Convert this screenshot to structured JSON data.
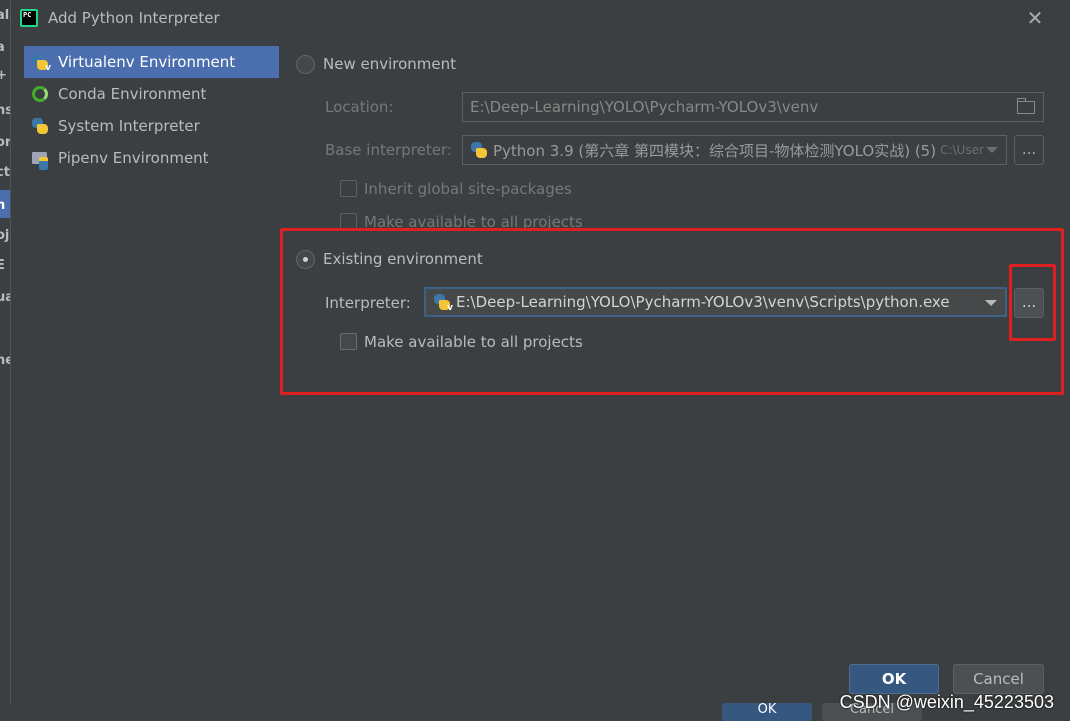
{
  "window": {
    "title": "Add Python Interpreter",
    "close_symbol": "✕"
  },
  "sidebar": {
    "items": [
      {
        "label": "Virtualenv Environment",
        "icon": "virtualenv-icon",
        "active": true
      },
      {
        "label": "Conda Environment",
        "icon": "conda-icon",
        "active": false
      },
      {
        "label": "System Interpreter",
        "icon": "python-icon",
        "active": false
      },
      {
        "label": "Pipenv Environment",
        "icon": "pipenv-icon",
        "active": false
      }
    ]
  },
  "new_env": {
    "radio_label": "New environment",
    "location_label": "Location:",
    "location_value": "E:\\Deep-Learning\\YOLO\\Pycharm-YOLOv3\\venv",
    "base_label": "Base interpreter:",
    "base_value": "Python 3.9 (第六章 第四模块：综合项目-物体检测YOLO实战) (5)",
    "base_suffix": "C:\\User",
    "browse_label": "...",
    "inherit_label": "Inherit global site-packages",
    "make_available_label": "Make available to all projects"
  },
  "existing_env": {
    "radio_label": "Existing environment",
    "interpreter_label": "Interpreter:",
    "interpreter_value": "E:\\Deep-Learning\\YOLO\\Pycharm-YOLOv3\\venv\\Scripts\\python.exe",
    "browse_label": "...",
    "make_available_label": "Make available to all projects"
  },
  "buttons": {
    "ok": "OK",
    "cancel": "Cancel"
  },
  "background": {
    "left_fragments": [
      "al",
      "a",
      "+",
      "ns",
      "or",
      "ct",
      "h",
      "oj",
      "E",
      "ua",
      "ne"
    ],
    "bottom_ok": "OK",
    "bottom_cancel": "Cancel"
  },
  "watermark": "CSDN @weixin_45223503",
  "colors": {
    "accent": "#4b6eaf",
    "highlight": "#e02020",
    "ok_button": "#365880",
    "dialog_bg": "#3c3f41"
  }
}
